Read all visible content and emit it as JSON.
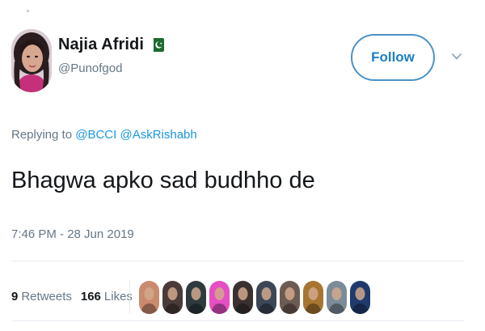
{
  "author": {
    "display_name": "Najia Afridi",
    "handle": "@Punofgod",
    "flag_icon": "pakistan-flag-icon",
    "avatar_icon": "profile-photo"
  },
  "follow_button": {
    "label": "Follow"
  },
  "menu_icon": "chevron-down-icon",
  "reply": {
    "prefix": "Replying to",
    "mentions": [
      "@BCCI",
      "@AskRishabh"
    ]
  },
  "tweet": {
    "text": "Bhagwa apko sad budhho de",
    "timestamp": "7:46 PM - 28 Jun 2019"
  },
  "stats": {
    "retweets_count": "9",
    "retweets_label": "Retweets",
    "likes_count": "166",
    "likes_label": "Likes"
  },
  "likers": [
    {
      "name": "liker-avatar-1",
      "color": "#c98a6e"
    },
    {
      "name": "liker-avatar-2",
      "color": "#4a3a3a"
    },
    {
      "name": "liker-avatar-3",
      "color": "#2f3a3f"
    },
    {
      "name": "liker-avatar-4",
      "color": "#e44fc2"
    },
    {
      "name": "liker-avatar-5",
      "color": "#3a3030"
    },
    {
      "name": "liker-avatar-6",
      "color": "#3d4656"
    },
    {
      "name": "liker-avatar-7",
      "color": "#6d5a52"
    },
    {
      "name": "liker-avatar-8",
      "color": "#a7752f"
    },
    {
      "name": "liker-avatar-9",
      "color": "#7b8b99"
    },
    {
      "name": "liker-avatar-10",
      "color": "#1f3a6b"
    }
  ],
  "colors": {
    "link": "#1b95e0",
    "follow_border": "#4b92c6",
    "secondary_text": "#657786",
    "primary_text": "#14171a",
    "divider": "#e6ecf0"
  }
}
